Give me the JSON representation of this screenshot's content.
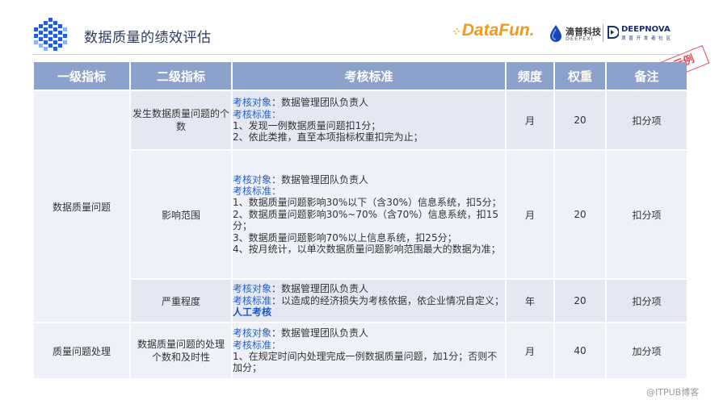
{
  "page": {
    "title": "数据质量的绩效评估"
  },
  "brands": {
    "datafun": "DataFun.",
    "didi_cn": "滴普科技",
    "didi_en": "DEEPEXI",
    "deep_word": "DEEPNOVA",
    "deep_sub": "滴 普 开 发 者 社 区"
  },
  "stamp": "示例",
  "table": {
    "headers": [
      "一级指标",
      "二级指标",
      "考核标准",
      "频度",
      "权重",
      "备注"
    ],
    "groups": [
      {
        "level1": "数据质量问题",
        "rows": [
          {
            "level2": "发生数据质量问题的个数",
            "obj_label": "考核对象",
            "obj_value": "：数据管理团队负责人",
            "std_label": "考核标准：",
            "lines": [
              "1、发现一例数据质量问题扣1分；",
              "2、依此类推，直至本项指标权重扣完为止；"
            ],
            "freq": "月",
            "weight": "20",
            "note": "扣分项"
          },
          {
            "level2": "影响范围",
            "obj_label": "考核对象",
            "obj_value": "：数据管理团队负责人",
            "std_label": "考核标准：",
            "lines": [
              "1、数据质量问题影响30%以下（含30%）信息系统，扣5分；",
              "2、数据质量问题影响30%~70%（含70%）信息系统，扣15分；",
              "3、数据质量问题影响70%以上信息系统，扣25分；",
              "4、按月统计，以单次数据质量问题影响范围最大的数据为准；"
            ],
            "freq": "月",
            "weight": "20",
            "note": "扣分项"
          },
          {
            "level2": "严重程度",
            "obj_label": "考核对象",
            "obj_value": "：数据管理团队负责人",
            "std_label": "考核标准",
            "std_text": "：以造成的经济损失为考核依据，依企业情况自定义；",
            "std_bold": "人工考核",
            "freq": "年",
            "weight": "20",
            "note": "扣分项"
          }
        ]
      },
      {
        "level1": "质量问题处理",
        "rows": [
          {
            "level2": "数据质量问题的处理个数和及时性",
            "obj_label": "考核对象",
            "obj_value": "：数据管理团队负责人",
            "std_label": "考核标准：",
            "lines": [
              "1、在规定时间内处理完成一例数据质量问题，加1分；否则不加分；"
            ],
            "freq": "月",
            "weight": "40",
            "note": "加分项"
          }
        ]
      }
    ]
  },
  "watermark": "@ITPUB博客"
}
